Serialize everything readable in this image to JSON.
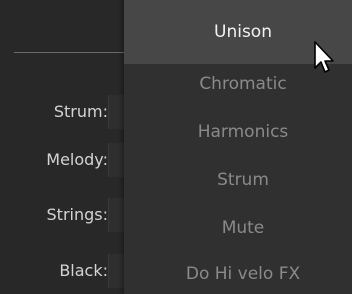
{
  "params": {
    "labels": [
      "Strum:",
      "Melody:",
      "Strings:",
      "Black:"
    ]
  },
  "dropdown": {
    "items": [
      "Unison",
      "Chromatic",
      "Harmonics",
      "Strum",
      "Mute",
      "Do Hi velo FX"
    ],
    "selected_index": 0
  },
  "cursor": {
    "icon": "mouse-pointer-icon"
  }
}
